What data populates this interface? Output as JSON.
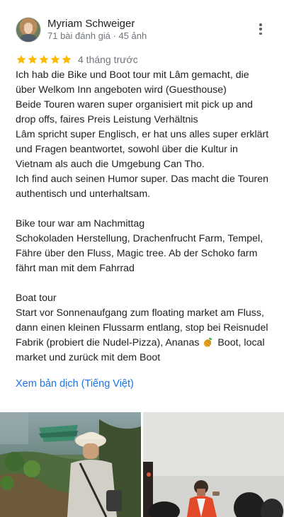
{
  "reviewer": {
    "name": "Myriam Schweiger",
    "meta": "71 bài đánh giá · 45 ảnh"
  },
  "rating": {
    "stars": 5,
    "max": 5,
    "star_color": "#fbbc04",
    "time_ago": "4 tháng trước"
  },
  "review": {
    "lines": [
      "Ich hab die Bike und Boot tour mit Lâm gemacht, die",
      "über Welkom Inn angeboten wird (Guesthouse)",
      "Beide Touren waren super organisiert mit pick up and",
      "drop offs, faires Preis Leistung Verhältnis",
      "Lâm spricht super Englisch, er hat uns alles super erklärt",
      "und Fragen beantwortet, sowohl über die Kultur in",
      "Vietnam als auch die Umgebung Can Tho.",
      "Ich find auch seinen Humor super. Das macht die Touren",
      "authentisch und unterhaltsam.",
      "",
      "Bike tour war am Nachmittag",
      "Schokoladen Herstellung, Drachenfrucht Farm, Tempel,",
      "Fähre über den Fluss, Magic tree. Ab der Schoko farm",
      "fährt man mit dem Fahrrad",
      "",
      "Boat tour",
      "Start vor Sonnenaufgang zum floating market am Fluss,",
      "dann einen kleinen Flussarm entlang, stop bei Reisnudel",
      "Fabrik (probiert die Nudel-Pizza), Ananas",
      "market und zurück mit dem Boot"
    ],
    "line19_after_icon": "Boot, local",
    "inline_icon": "pineapple-emoji"
  },
  "translate_link": "Xem bản dịch (Tiếng Việt)",
  "icons": {
    "more": "more-vert-icon",
    "star": "star-icon"
  },
  "colors": {
    "link": "#1a73e8",
    "secondary_text": "#70757a"
  }
}
